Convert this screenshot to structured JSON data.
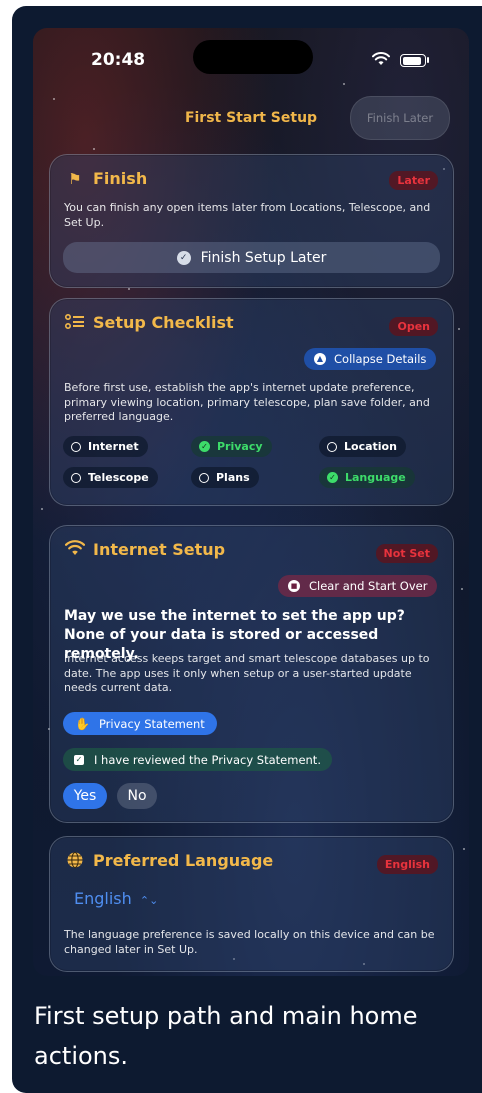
{
  "status_bar": {
    "time": "20:48"
  },
  "nav": {
    "title": "First Start Setup",
    "finish_later_label": "Finish Later"
  },
  "finish_card": {
    "title": "Finish",
    "badge": "Later",
    "description": "You can finish any open items later from Locations, Telescope, and Set Up.",
    "button_label": "Finish Setup Later"
  },
  "checklist_card": {
    "title": "Setup Checklist",
    "badge": "Open",
    "collapse_label": "Collapse Details",
    "description": "Before first use, establish the app's internet update preference, primary viewing location, primary telescope, plan save folder, and preferred language.",
    "items": [
      {
        "label": "Internet",
        "done": false
      },
      {
        "label": "Privacy",
        "done": true
      },
      {
        "label": "Location",
        "done": false
      },
      {
        "label": "Telescope",
        "done": false
      },
      {
        "label": "Plans",
        "done": false
      },
      {
        "label": "Language",
        "done": true
      }
    ]
  },
  "internet_card": {
    "title": "Internet Setup",
    "badge": "Not Set",
    "clear_label": "Clear and Start Over",
    "question": "May we use the internet to set the app up? None of your data is stored or accessed remotely.",
    "description": "Internet access keeps target and smart telescope databases up to date. The app uses it only when setup or a user-started update needs current data.",
    "privacy_button": "Privacy Statement",
    "reviewed_label": "I have reviewed the Privacy Statement.",
    "yes_label": "Yes",
    "no_label": "No"
  },
  "language_card": {
    "title": "Preferred Language",
    "badge": "English",
    "selected_language": "English",
    "description": "The language preference is saved locally on this device and can be changed later in Set Up."
  },
  "caption": "First setup path and main home actions.",
  "colors": {
    "accent": "#f2b84a",
    "badge_red": "#e8333d",
    "button_blue": "#2f74e8",
    "check_green": "#3ddc6a",
    "card_bg": "#2a3d60"
  }
}
